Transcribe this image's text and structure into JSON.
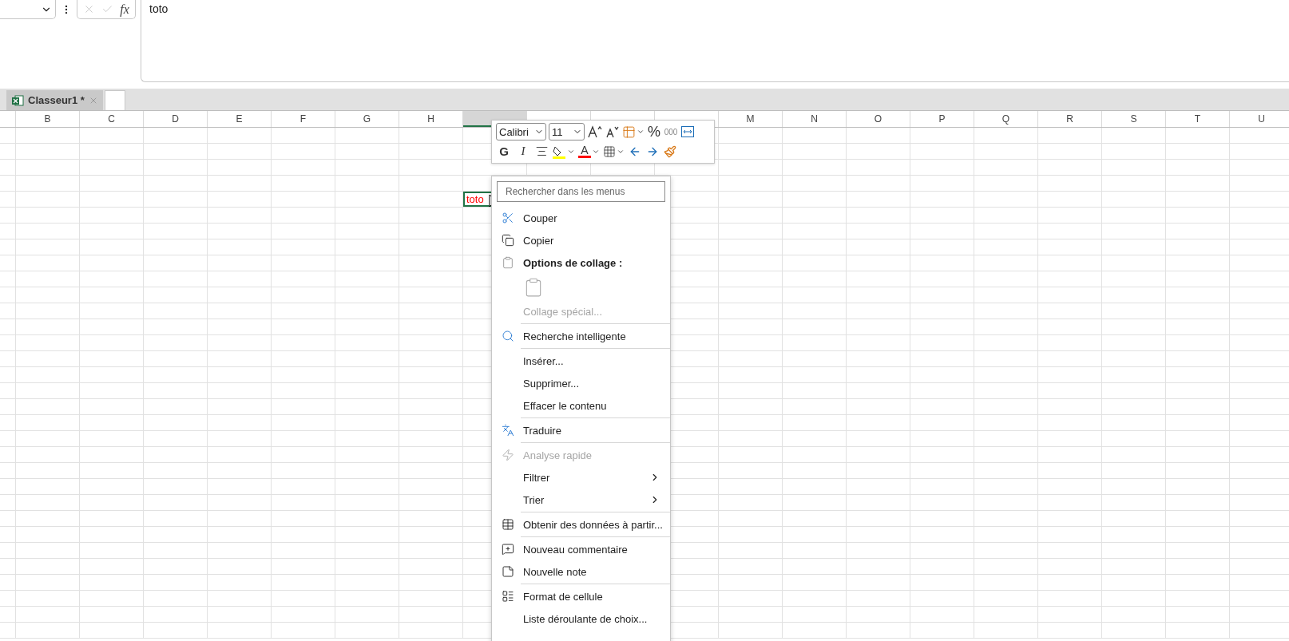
{
  "formula_bar": {
    "function_label": "fx",
    "value": "toto"
  },
  "sheet_tabs": [
    {
      "label": "Classeur1 *",
      "selected": true
    }
  ],
  "columns": [
    {
      "label": "B",
      "selected": false
    },
    {
      "label": "C",
      "selected": false
    },
    {
      "label": "D",
      "selected": false
    },
    {
      "label": "E",
      "selected": false
    },
    {
      "label": "F",
      "selected": false
    },
    {
      "label": "G",
      "selected": false
    },
    {
      "label": "H",
      "selected": false
    },
    {
      "selected": true
    },
    {
      "selected": false
    },
    {
      "selected": false
    },
    {
      "selected": false
    },
    {
      "label": "M",
      "selected": false
    },
    {
      "label": "N",
      "selected": false
    },
    {
      "label": "O",
      "selected": false
    },
    {
      "label": "P",
      "selected": false
    },
    {
      "label": "Q",
      "selected": false
    },
    {
      "label": "R",
      "selected": false
    },
    {
      "label": "S",
      "selected": false
    },
    {
      "label": "T",
      "selected": false
    },
    {
      "label": "U",
      "selected": false
    }
  ],
  "active_cell": {
    "value": "toto",
    "color": "#ff0000"
  },
  "mini_toolbar": {
    "font": "Calibri",
    "size": "11",
    "row_1": [
      {
        "kind": "grow"
      },
      {
        "kind": "shrink"
      },
      {
        "kind": "conditional"
      },
      {
        "kind": "percent",
        "label": "%"
      },
      {
        "kind": "thousands",
        "label": "000"
      },
      {
        "kind": "wrap"
      }
    ],
    "row_2": [
      {
        "kind": "bold",
        "label": "G"
      },
      {
        "kind": "italic",
        "label": "I"
      },
      {
        "kind": "align"
      },
      {
        "kind": "fill",
        "color": "#ffff00"
      },
      {
        "kind": "font-color",
        "label": "A",
        "color": "#ff0000"
      },
      {
        "kind": "borders"
      },
      {
        "kind": "decrease-decimals"
      },
      {
        "kind": "increase-decimals"
      },
      {
        "kind": "painter"
      }
    ]
  },
  "context_menu": {
    "search": {
      "placeholder": "Rechercher dans les menus"
    },
    "items": [
      {
        "kind": "item",
        "label": "Couper",
        "disabled": false,
        "submenu": false
      },
      {
        "kind": "item",
        "label": "Copier",
        "disabled": false,
        "submenu": false
      },
      {
        "kind": "header",
        "label": "Options de collage :"
      },
      {
        "kind": "paste-options"
      },
      {
        "kind": "item",
        "label": "Collage spécial...",
        "disabled": true,
        "submenu": false
      },
      {
        "kind": "separator"
      },
      {
        "kind": "item",
        "label": "Recherche intelligente",
        "disabled": false,
        "submenu": false
      },
      {
        "kind": "separator"
      },
      {
        "kind": "item",
        "label": "Insérer...",
        "disabled": false,
        "submenu": false
      },
      {
        "kind": "item",
        "label": "Supprimer...",
        "disabled": false,
        "submenu": false
      },
      {
        "kind": "item",
        "label": "Effacer le contenu",
        "disabled": false,
        "submenu": false
      },
      {
        "kind": "separator"
      },
      {
        "kind": "item",
        "label": "Traduire",
        "disabled": false,
        "submenu": false
      },
      {
        "kind": "separator"
      },
      {
        "kind": "item",
        "label": "Analyse rapide",
        "disabled": true,
        "submenu": false
      },
      {
        "kind": "item",
        "label": "Filtrer",
        "disabled": false,
        "submenu": true
      },
      {
        "kind": "item",
        "label": "Trier",
        "disabled": false,
        "submenu": true
      },
      {
        "kind": "separator"
      },
      {
        "kind": "item",
        "label": "Obtenir des données à partir...",
        "disabled": false,
        "submenu": false
      },
      {
        "kind": "separator"
      },
      {
        "kind": "item",
        "label": "Nouveau commentaire",
        "disabled": false,
        "submenu": false
      },
      {
        "kind": "item",
        "label": "Nouvelle note",
        "disabled": false,
        "submenu": false
      },
      {
        "kind": "separator"
      },
      {
        "kind": "item",
        "label": "Format de cellule",
        "disabled": false,
        "submenu": false
      },
      {
        "kind": "item",
        "label": "Liste déroulante de choix...",
        "disabled": false,
        "submenu": false
      }
    ]
  }
}
